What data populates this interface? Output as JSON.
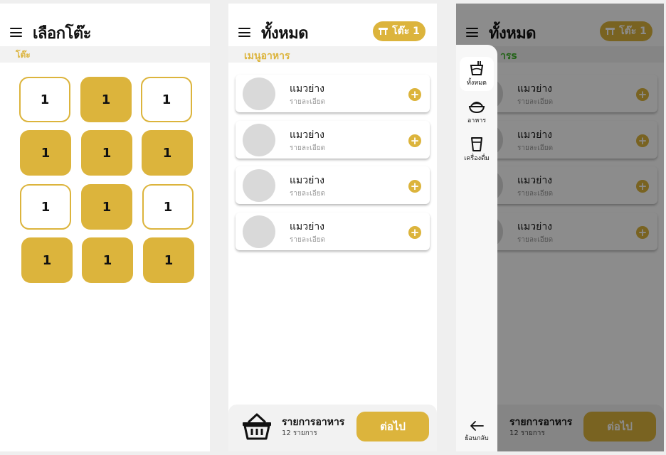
{
  "screen1": {
    "title": "เลือกโต๊ะ",
    "section_label": "โต๊ะ",
    "tables": [
      {
        "label": "1",
        "status": "free"
      },
      {
        "label": "1",
        "status": "busy"
      },
      {
        "label": "1",
        "status": "free"
      },
      {
        "label": "1",
        "status": "busy"
      },
      {
        "label": "1",
        "status": "busy"
      },
      {
        "label": "1",
        "status": "busy"
      },
      {
        "label": "1",
        "status": "free"
      },
      {
        "label": "1",
        "status": "busy"
      },
      {
        "label": "1",
        "status": "free"
      },
      {
        "label": "1",
        "status": "busy"
      },
      {
        "label": "1",
        "status": "busy"
      },
      {
        "label": "1",
        "status": "busy"
      }
    ]
  },
  "screen2": {
    "title": "ทั้งหมด",
    "table_pill": "โต๊ะ 1",
    "section_label": "เมนูอาหาร",
    "items": [
      {
        "name": "แมวย่าง",
        "desc": "รายละเอียด"
      },
      {
        "name": "แมวย่าง",
        "desc": "รายละเอียด"
      },
      {
        "name": "แมวย่าง",
        "desc": "รายละเอียด"
      },
      {
        "name": "แมวย่าง",
        "desc": "รายละเอียด"
      }
    ],
    "bottom": {
      "title": "รายการอาหาร",
      "count": "12 รายการ",
      "next_label": "ต่อไป"
    }
  },
  "screen3": {
    "title": "ทั้งหมด",
    "table_pill": "โต๊ะ 1",
    "section_label": "ารs",
    "items": [
      {
        "name": "แมวย่าง",
        "desc": "รายละเอียด"
      },
      {
        "name": "แมวย่าง",
        "desc": "รายละเอียด"
      },
      {
        "name": "แมวย่าง",
        "desc": "รายละเอียด"
      },
      {
        "name": "แมวย่าง",
        "desc": "รายละเอียด"
      }
    ],
    "bottom": {
      "title": "รายการอาหาร",
      "count": "12 รายการ",
      "next_label": "ต่อไป"
    },
    "side_panel": {
      "categories": [
        {
          "label": "ทั้งหมด",
          "icon": "all-food-icon",
          "active": true
        },
        {
          "label": "อาหาร",
          "icon": "rice-bowl-icon",
          "active": false
        },
        {
          "label": "เครื่องดื่ม",
          "icon": "drink-cup-icon",
          "active": false
        }
      ],
      "back_label": "ย้อนกลับ"
    }
  },
  "colors": {
    "accent": "#dcb43c",
    "background": "#efefef",
    "card": "#ffffff"
  }
}
